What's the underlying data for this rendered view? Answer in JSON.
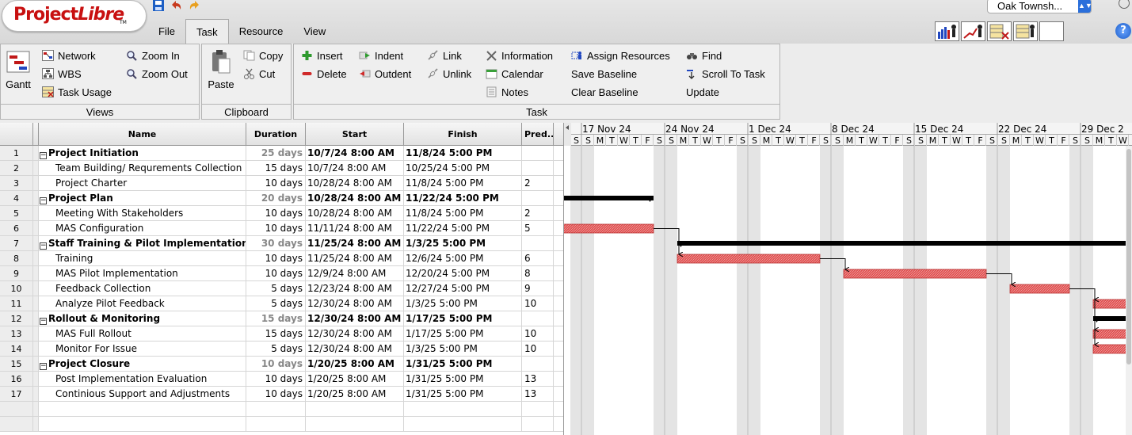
{
  "app": {
    "logo": "ProjectLibre",
    "logo_part1": "Project",
    "logo_part2": "Libre",
    "logo_tm": "TM"
  },
  "quick_access": [
    {
      "name": "save-icon",
      "color": "#1d5fc4"
    },
    {
      "name": "undo-icon",
      "color": "#c83a1e"
    },
    {
      "name": "redo-icon",
      "color": "#e8a020"
    }
  ],
  "menu_tabs": [
    {
      "label": "File",
      "active": false
    },
    {
      "label": "Task",
      "active": true
    },
    {
      "label": "Resource",
      "active": false
    },
    {
      "label": "View",
      "active": false
    }
  ],
  "project_selector": {
    "value": "Oak Townsh..."
  },
  "help_label": "?",
  "ribbon": {
    "views": {
      "title": "Views",
      "gantt": "Gantt",
      "network": "Network",
      "wbs": "WBS",
      "task_usage": "Task Usage",
      "zoom_in": "Zoom In",
      "zoom_out": "Zoom Out"
    },
    "clipboard": {
      "title": "Clipboard",
      "paste": "Paste",
      "copy": "Copy",
      "cut": "Cut"
    },
    "task": {
      "title": "Task",
      "insert": "Insert",
      "delete": "Delete",
      "indent": "Indent",
      "outdent": "Outdent",
      "link": "Link",
      "unlink": "Unlink",
      "information": "Information",
      "calendar": "Calendar",
      "notes": "Notes",
      "assign_resources": "Assign Resources",
      "save_baseline": "Save Baseline",
      "clear_baseline": "Clear Baseline",
      "find": "Find",
      "scroll_to_task": "Scroll To Task",
      "update": "Update"
    }
  },
  "table": {
    "headers": {
      "name": "Name",
      "duration": "Duration",
      "start": "Start",
      "finish": "Finish",
      "predecessors": "Pred..."
    },
    "rows": [
      {
        "id": "1",
        "name": "Project Initiation",
        "summary": true,
        "duration": "25 days",
        "start": "10/7/24 8:00 AM",
        "finish": "11/8/24 5:00 PM",
        "pred": ""
      },
      {
        "id": "2",
        "name": "Team Building/ Requrements Collection",
        "summary": false,
        "duration": "15 days",
        "start": "10/7/24 8:00 AM",
        "finish": "10/25/24 5:00 PM",
        "pred": ""
      },
      {
        "id": "3",
        "name": "Project Charter",
        "summary": false,
        "duration": "10 days",
        "start": "10/28/24 8:00 AM",
        "finish": "11/8/24 5:00 PM",
        "pred": "2"
      },
      {
        "id": "4",
        "name": "Project Plan",
        "summary": true,
        "duration": "20 days",
        "start": "10/28/24 8:00 AM",
        "finish": "11/22/24 5:00 PM",
        "pred": ""
      },
      {
        "id": "5",
        "name": "Meeting With Stakeholders",
        "summary": false,
        "duration": "10 days",
        "start": "10/28/24 8:00 AM",
        "finish": "11/8/24 5:00 PM",
        "pred": "2"
      },
      {
        "id": "6",
        "name": "MAS Configuration",
        "summary": false,
        "duration": "10 days",
        "start": "11/11/24 8:00 AM",
        "finish": "11/22/24 5:00 PM",
        "pred": "5"
      },
      {
        "id": "7",
        "name": "Staff Training & Pilot Implementation",
        "summary": true,
        "duration": "30 days",
        "start": "11/25/24 8:00 AM",
        "finish": "1/3/25 5:00 PM",
        "pred": ""
      },
      {
        "id": "8",
        "name": "Training",
        "summary": false,
        "duration": "10 days",
        "start": "11/25/24 8:00 AM",
        "finish": "12/6/24 5:00 PM",
        "pred": "6"
      },
      {
        "id": "9",
        "name": "MAS Pilot Implementation",
        "summary": false,
        "duration": "10 days",
        "start": "12/9/24 8:00 AM",
        "finish": "12/20/24 5:00 PM",
        "pred": "8"
      },
      {
        "id": "10",
        "name": "Feedback Collection",
        "summary": false,
        "duration": "5 days",
        "start": "12/23/24 8:00 AM",
        "finish": "12/27/24 5:00 PM",
        "pred": "9"
      },
      {
        "id": "11",
        "name": "Analyze Pilot Feedback",
        "summary": false,
        "duration": "5 days",
        "start": "12/30/24 8:00 AM",
        "finish": "1/3/25 5:00 PM",
        "pred": "10"
      },
      {
        "id": "12",
        "name": "Rollout & Monitoring",
        "summary": true,
        "duration": "15 days",
        "start": "12/30/24 8:00 AM",
        "finish": "1/17/25 5:00 PM",
        "pred": ""
      },
      {
        "id": "13",
        "name": "MAS Full Rollout",
        "summary": false,
        "duration": "15 days",
        "start": "12/30/24 8:00 AM",
        "finish": "1/17/25 5:00 PM",
        "pred": "10"
      },
      {
        "id": "14",
        "name": "Monitor For Issue",
        "summary": false,
        "duration": "5 days",
        "start": "12/30/24 8:00 AM",
        "finish": "1/3/25 5:00 PM",
        "pred": "10"
      },
      {
        "id": "15",
        "name": "Project Closure",
        "summary": true,
        "duration": "10 days",
        "start": "1/20/25 8:00 AM",
        "finish": "1/31/25 5:00 PM",
        "pred": ""
      },
      {
        "id": "16",
        "name": "Post Implementation Evaluation",
        "summary": false,
        "duration": "10 days",
        "start": "1/20/25 8:00 AM",
        "finish": "1/31/25 5:00 PM",
        "pred": "13"
      },
      {
        "id": "17",
        "name": "Continious Support and Adjustments",
        "summary": false,
        "duration": "10 days",
        "start": "1/20/25 8:00 AM",
        "finish": "1/31/25 5:00 PM",
        "pred": "13"
      }
    ],
    "empty_rows": 2
  },
  "gantt": {
    "weeks": [
      "17 Nov 24",
      "24 Nov 24",
      "1 Dec 24",
      "8 Dec 24",
      "15 Dec 24",
      "22 Dec 24",
      "29 Dec 2"
    ],
    "day_letters": [
      "S",
      "M",
      "T",
      "W",
      "T",
      "F",
      "S"
    ],
    "colors": {
      "normal": "#e05050",
      "critical": "#3a55c8",
      "summary": "#000000",
      "weekend": "#e4e4e4"
    }
  }
}
